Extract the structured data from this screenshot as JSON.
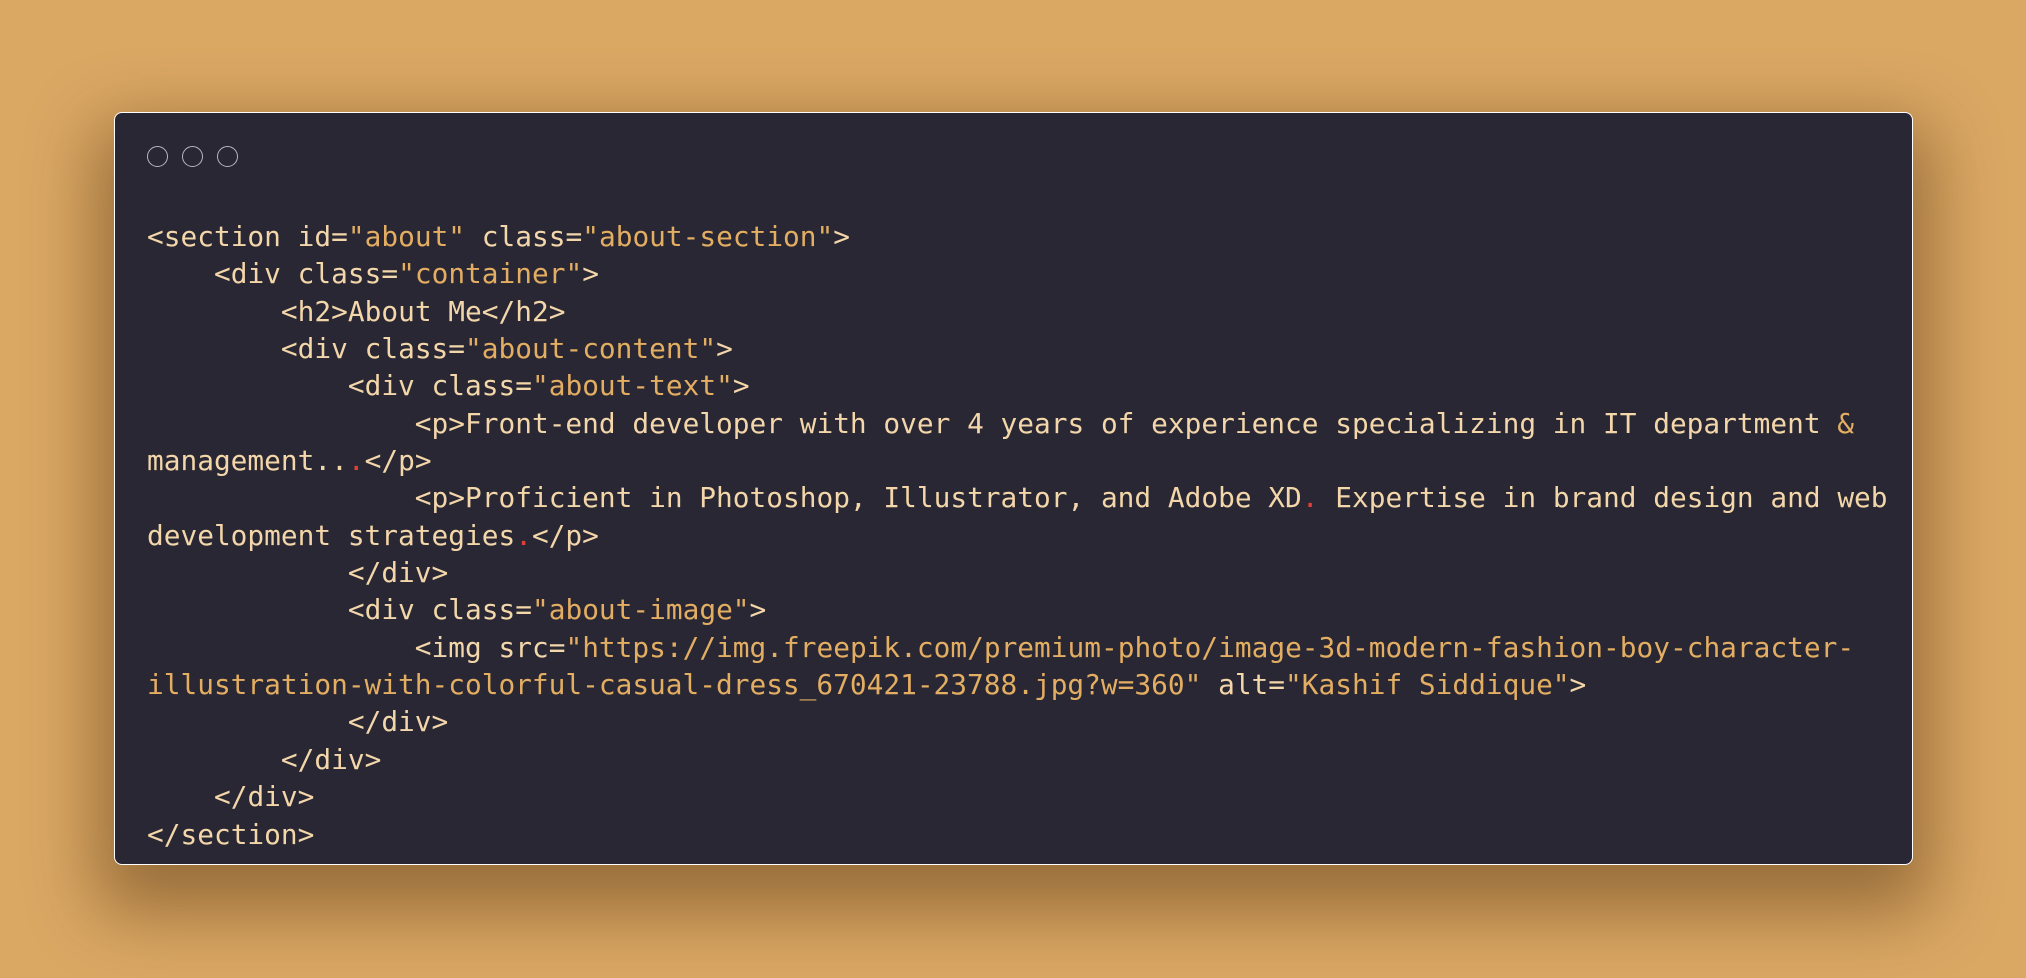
{
  "colors": {
    "background": "#dba864",
    "window": "#282733",
    "window_border": "#ffffff",
    "dot_outline": "#b7b7bf",
    "code_text": "#f3d6a9",
    "string": "#e3ad62",
    "error_mark": "#e0403a"
  },
  "window": {
    "controls": [
      "circle-icon",
      "circle-icon",
      "circle-icon"
    ]
  },
  "code": {
    "language": "html",
    "lines": [
      [
        {
          "t": "<",
          "k": "punct"
        },
        {
          "t": "section",
          "k": "tag"
        },
        {
          "t": " ",
          "k": "text"
        },
        {
          "t": "id",
          "k": "attr"
        },
        {
          "t": "=",
          "k": "punct"
        },
        {
          "t": "\"about\"",
          "k": "string"
        },
        {
          "t": " ",
          "k": "text"
        },
        {
          "t": "class",
          "k": "attr"
        },
        {
          "t": "=",
          "k": "punct"
        },
        {
          "t": "\"about-section\"",
          "k": "string"
        },
        {
          "t": ">",
          "k": "punct"
        }
      ],
      [
        {
          "t": "    ",
          "k": "text"
        },
        {
          "t": "<",
          "k": "punct"
        },
        {
          "t": "div",
          "k": "tag"
        },
        {
          "t": " ",
          "k": "text"
        },
        {
          "t": "class",
          "k": "attr"
        },
        {
          "t": "=",
          "k": "punct"
        },
        {
          "t": "\"container\"",
          "k": "string"
        },
        {
          "t": ">",
          "k": "punct"
        }
      ],
      [
        {
          "t": "        ",
          "k": "text"
        },
        {
          "t": "<",
          "k": "punct"
        },
        {
          "t": "h2",
          "k": "tag"
        },
        {
          "t": ">",
          "k": "punct"
        },
        {
          "t": "About Me",
          "k": "text"
        },
        {
          "t": "</",
          "k": "punct"
        },
        {
          "t": "h2",
          "k": "tag"
        },
        {
          "t": ">",
          "k": "punct"
        }
      ],
      [
        {
          "t": "        ",
          "k": "text"
        },
        {
          "t": "<",
          "k": "punct"
        },
        {
          "t": "div",
          "k": "tag"
        },
        {
          "t": " ",
          "k": "text"
        },
        {
          "t": "class",
          "k": "attr"
        },
        {
          "t": "=",
          "k": "punct"
        },
        {
          "t": "\"about-content\"",
          "k": "string"
        },
        {
          "t": ">",
          "k": "punct"
        }
      ],
      [
        {
          "t": "            ",
          "k": "text"
        },
        {
          "t": "<",
          "k": "punct"
        },
        {
          "t": "div",
          "k": "tag"
        },
        {
          "t": " ",
          "k": "text"
        },
        {
          "t": "class",
          "k": "attr"
        },
        {
          "t": "=",
          "k": "punct"
        },
        {
          "t": "\"about-text\"",
          "k": "string"
        },
        {
          "t": ">",
          "k": "punct"
        }
      ],
      [
        {
          "t": "                ",
          "k": "text"
        },
        {
          "t": "<",
          "k": "punct"
        },
        {
          "t": "p",
          "k": "tag"
        },
        {
          "t": ">",
          "k": "punct"
        },
        {
          "t": "Front-end developer with over 4 years of experience specializing in IT department ",
          "k": "text"
        },
        {
          "t": "&",
          "k": "entity"
        }
      ],
      [
        {
          "t": "management",
          "k": "text"
        },
        {
          "t": "..",
          "k": "text"
        },
        {
          "t": ".",
          "k": "error"
        },
        {
          "t": "</",
          "k": "punct"
        },
        {
          "t": "p",
          "k": "tag"
        },
        {
          "t": ">",
          "k": "punct"
        }
      ],
      [
        {
          "t": "                ",
          "k": "text"
        },
        {
          "t": "<",
          "k": "punct"
        },
        {
          "t": "p",
          "k": "tag"
        },
        {
          "t": ">",
          "k": "punct"
        },
        {
          "t": "Proficient in Photoshop, Illustrator, and Adobe XD",
          "k": "text"
        },
        {
          "t": ".",
          "k": "error"
        },
        {
          "t": " Expertise in brand design and web",
          "k": "text"
        }
      ],
      [
        {
          "t": "development strategies",
          "k": "text"
        },
        {
          "t": ".",
          "k": "error"
        },
        {
          "t": "</",
          "k": "punct"
        },
        {
          "t": "p",
          "k": "tag"
        },
        {
          "t": ">",
          "k": "punct"
        }
      ],
      [
        {
          "t": "            ",
          "k": "text"
        },
        {
          "t": "</",
          "k": "punct"
        },
        {
          "t": "div",
          "k": "tag"
        },
        {
          "t": ">",
          "k": "punct"
        }
      ],
      [
        {
          "t": "            ",
          "k": "text"
        },
        {
          "t": "<",
          "k": "punct"
        },
        {
          "t": "div",
          "k": "tag"
        },
        {
          "t": " ",
          "k": "text"
        },
        {
          "t": "class",
          "k": "attr"
        },
        {
          "t": "=",
          "k": "punct"
        },
        {
          "t": "\"about-image\"",
          "k": "string"
        },
        {
          "t": ">",
          "k": "punct"
        }
      ],
      [
        {
          "t": "                ",
          "k": "text"
        },
        {
          "t": "<",
          "k": "punct"
        },
        {
          "t": "img",
          "k": "tag"
        },
        {
          "t": " ",
          "k": "text"
        },
        {
          "t": "src",
          "k": "attr"
        },
        {
          "t": "=",
          "k": "punct"
        },
        {
          "t": "\"https://img.freepik.com/premium-photo/image-3d-modern-fashion-boy-character-",
          "k": "string"
        }
      ],
      [
        {
          "t": "illustration-with-colorful-casual-dress_670421-23788.jpg?w=360\"",
          "k": "string"
        },
        {
          "t": " ",
          "k": "text"
        },
        {
          "t": "alt",
          "k": "attr"
        },
        {
          "t": "=",
          "k": "punct"
        },
        {
          "t": "\"Kashif Siddique\"",
          "k": "string"
        },
        {
          "t": ">",
          "k": "punct"
        }
      ],
      [
        {
          "t": "            ",
          "k": "text"
        },
        {
          "t": "</",
          "k": "punct"
        },
        {
          "t": "div",
          "k": "tag"
        },
        {
          "t": ">",
          "k": "punct"
        }
      ],
      [
        {
          "t": "        ",
          "k": "text"
        },
        {
          "t": "</",
          "k": "punct"
        },
        {
          "t": "div",
          "k": "tag"
        },
        {
          "t": ">",
          "k": "punct"
        }
      ],
      [
        {
          "t": "    ",
          "k": "text"
        },
        {
          "t": "</",
          "k": "punct"
        },
        {
          "t": "div",
          "k": "tag"
        },
        {
          "t": ">",
          "k": "punct"
        }
      ],
      [
        {
          "t": "</",
          "k": "punct"
        },
        {
          "t": "section",
          "k": "tag"
        },
        {
          "t": ">",
          "k": "punct"
        }
      ]
    ]
  }
}
